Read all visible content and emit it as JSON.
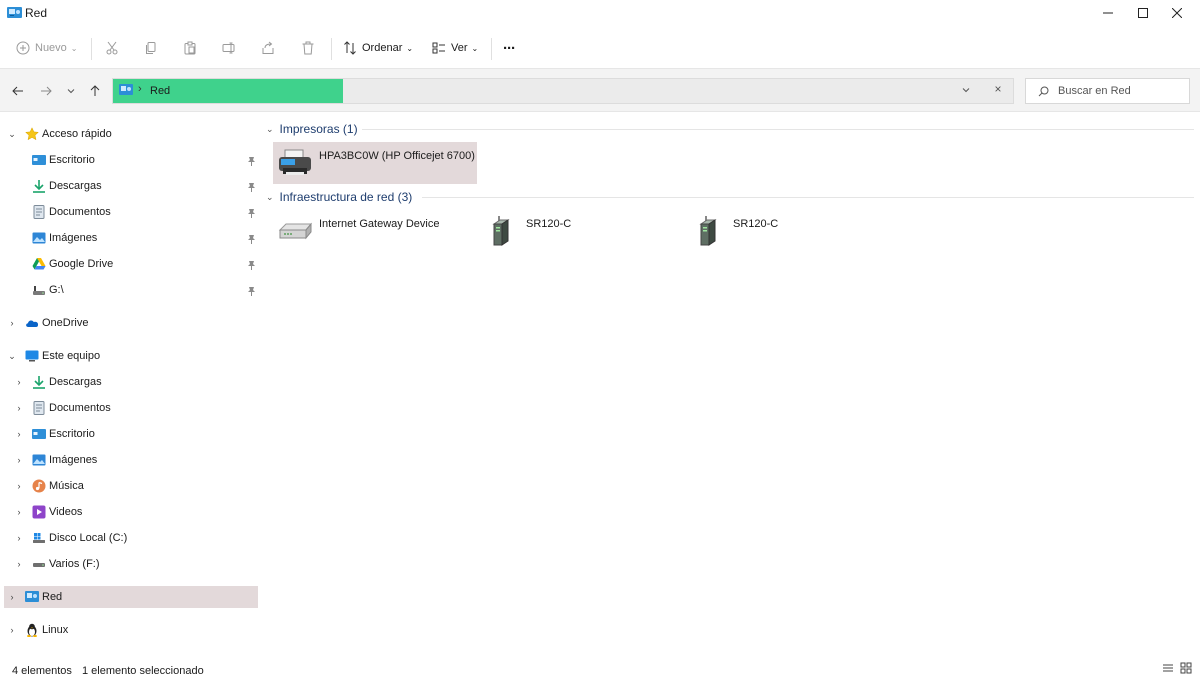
{
  "window": {
    "title": "Red"
  },
  "toolbar": {
    "new_label": "Nuevo",
    "sort_label": "Ordenar",
    "view_label": "Ver",
    "more_label": "···"
  },
  "address": {
    "crumb_sep": "›",
    "crumb": "Red",
    "clear": "×"
  },
  "search": {
    "placeholder": "Buscar en Red"
  },
  "sidebar": {
    "quick_access": {
      "label": "Acceso rápido",
      "items": [
        {
          "label": "Escritorio",
          "icon": "desktop-icon"
        },
        {
          "label": "Descargas",
          "icon": "download-icon"
        },
        {
          "label": "Documentos",
          "icon": "document-icon"
        },
        {
          "label": "Imágenes",
          "icon": "image-icon"
        },
        {
          "label": "Google Drive",
          "icon": "google-drive-icon"
        },
        {
          "label": "G:\\",
          "icon": "drive-icon"
        }
      ]
    },
    "onedrive": {
      "label": "OneDrive"
    },
    "this_pc": {
      "label": "Este equipo",
      "items": [
        {
          "label": "Descargas",
          "icon": "download-icon"
        },
        {
          "label": "Documentos",
          "icon": "document-icon"
        },
        {
          "label": "Escritorio",
          "icon": "desktop-icon"
        },
        {
          "label": "Imágenes",
          "icon": "image-icon"
        },
        {
          "label": "Música",
          "icon": "music-icon"
        },
        {
          "label": "Videos",
          "icon": "video-icon"
        },
        {
          "label": "Disco Local (C:)",
          "icon": "disk-icon"
        },
        {
          "label": "Varios (F:)",
          "icon": "drive-icon"
        }
      ]
    },
    "network": {
      "label": "Red"
    },
    "linux": {
      "label": "Linux"
    }
  },
  "content": {
    "groups": [
      {
        "header": "Impresoras (1)",
        "items": [
          {
            "label": "HPA3BC0W (HP Officejet 6700)",
            "icon": "printer-icon",
            "selected": true
          }
        ]
      },
      {
        "header": "Infraestructura de red (3)",
        "items": [
          {
            "label": "Internet Gateway Device",
            "icon": "router-icon"
          },
          {
            "label": "SR120-C",
            "icon": "network-device-icon"
          },
          {
            "label": "SR120-C",
            "icon": "network-device-icon"
          }
        ]
      }
    ]
  },
  "status": {
    "count": "4 elementos",
    "selection": "1 elemento seleccionado"
  },
  "colors": {
    "address_highlight": "#3fd28c",
    "selection": "#e3d9da",
    "group_header": "#1e3d6e"
  }
}
